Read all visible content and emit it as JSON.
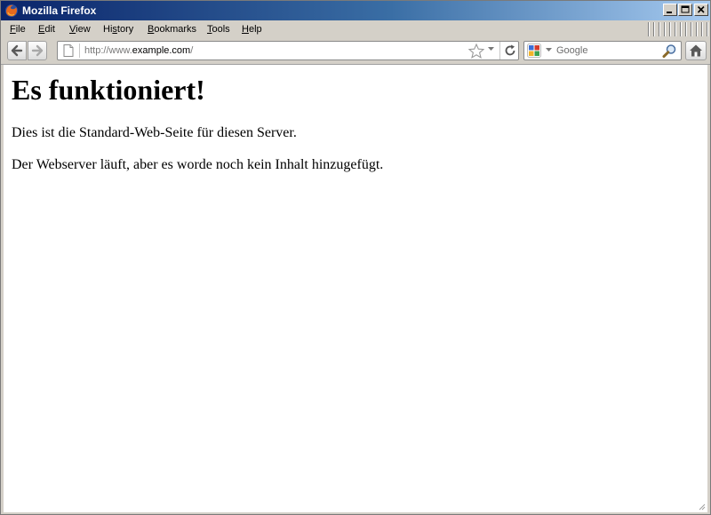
{
  "window": {
    "title": "Mozilla Firefox",
    "controls": {
      "minimize": "minimize",
      "maximize": "maximize",
      "close": "close"
    }
  },
  "menubar": {
    "items": [
      {
        "accel": "F",
        "rest": "ile"
      },
      {
        "accel": "E",
        "rest": "dit"
      },
      {
        "accel": "V",
        "rest": "iew"
      },
      {
        "pre": "Hi",
        "accel": "s",
        "rest": "tory"
      },
      {
        "accel": "B",
        "rest": "ookmarks"
      },
      {
        "accel": "T",
        "rest": "ools"
      },
      {
        "accel": "H",
        "rest": "elp"
      }
    ]
  },
  "navbar": {
    "url": {
      "protocol": "http://www.",
      "host": "example.com",
      "path": "/"
    },
    "search": {
      "engine": "Google",
      "placeholder": "Google"
    }
  },
  "page": {
    "heading": "Es funktioniert!",
    "paragraphs": [
      "Dies ist die Standard-Web-Seite für diesen Server.",
      "Der Webserver läuft, aber es worde noch kein Inhalt hinzugefügt."
    ]
  },
  "colors": {
    "titlebar_start": "#0a246a",
    "titlebar_end": "#a6caf0",
    "chrome": "#d4d0c8",
    "content_bg": "#ffffff"
  },
  "icons": {
    "app": "firefox-icon",
    "back": "back-arrow-icon",
    "forward": "forward-arrow-icon",
    "site": "page-icon",
    "bookmark": "star-icon",
    "reload": "reload-icon",
    "search_engine": "google-icon",
    "search": "magnifier-icon",
    "home": "home-icon"
  }
}
